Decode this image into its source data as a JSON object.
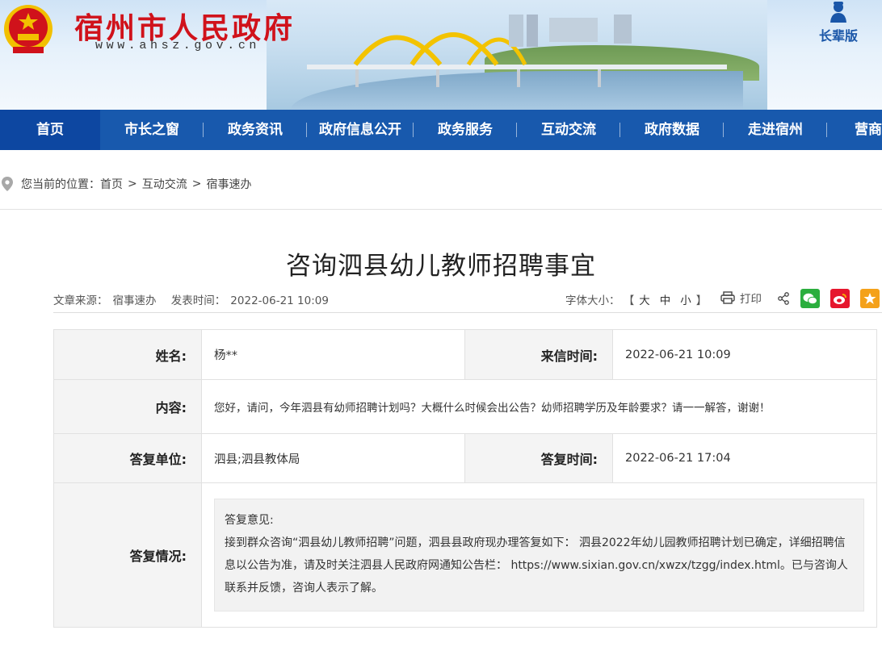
{
  "header": {
    "site_name": "宿州市人民政府",
    "site_url": "www.ahsz.gov.cn",
    "elder_label": "长辈版"
  },
  "nav": {
    "items": [
      {
        "label": "首页",
        "active": true
      },
      {
        "label": "市长之窗"
      },
      {
        "label": "政务资讯"
      },
      {
        "label": "政府信息公开"
      },
      {
        "label": "政务服务"
      },
      {
        "label": "互动交流"
      },
      {
        "label": "政府数据"
      },
      {
        "label": "走进宿州"
      },
      {
        "label": "营商"
      }
    ]
  },
  "breadcrumb": {
    "prefix": "您当前的位置：",
    "items": [
      "首页",
      "互动交流",
      "宿事速办"
    ],
    "separator": ">"
  },
  "article": {
    "title": "咨询泗县幼儿教师招聘事宜",
    "source_label": "文章来源：",
    "source": "宿事速办",
    "date_label": "发表时间：",
    "date": "2022-06-21 10:09",
    "font_size_label": "字体大小：",
    "font_sizes": [
      "大",
      "中",
      "小"
    ],
    "bracket_open": "【",
    "bracket_close": "】",
    "print_label": "打印"
  },
  "info": {
    "name_label": "姓名:",
    "name": "杨**",
    "sent_time_label": "来信时间:",
    "sent_time": "2022-06-21 10:09",
    "content_label": "内容:",
    "content": "您好，请问，今年泗县有幼师招聘计划吗？大概什么时候会出公告？幼师招聘学历及年龄要求？请一一解答，谢谢！",
    "reply_unit_label": "答复单位:",
    "reply_unit": "泗县;泗县教体局",
    "reply_time_label": "答复时间:",
    "reply_time": "2022-06-21 17:04",
    "reply_status_label": "答复情况:",
    "reply_heading": "答复意见:",
    "reply_body": "接到群众咨询“泗县幼儿教师招聘”问题，泗县县政府现办理答复如下： 泗县2022年幼儿园教师招聘计划已确定，详细招聘信息以公告为准，请及时关注泗县人民政府网通知公告栏： https://www.sixian.gov.cn/xwzx/tzgg/index.html。已与咨询人联系并反馈，咨询人表示了解。"
  },
  "colors": {
    "brand_red": "#d0121b",
    "nav_blue": "#1859ad",
    "wechat_green": "#2bae3e",
    "weibo_red": "#e6162d",
    "favorite_orange": "#f4a11a"
  },
  "icons": [
    "national-emblem",
    "elder-icon",
    "location-pin-icon",
    "printer-icon",
    "share-icon",
    "wechat-icon",
    "weibo-icon",
    "favorite-icon"
  ]
}
